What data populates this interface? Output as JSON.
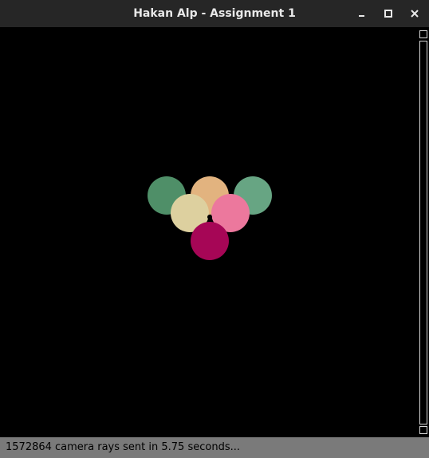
{
  "window": {
    "title": "Hakan Alp - Assignment 1",
    "controls": {
      "minimize_icon": "minimize-icon",
      "maximize_icon": "maximize-icon",
      "close_icon": "close-icon"
    }
  },
  "render": {
    "background": "#000000",
    "spheres": [
      {
        "name": "top-left",
        "color": "#4f8f68"
      },
      {
        "name": "top-center",
        "color": "#e2b37f"
      },
      {
        "name": "top-right",
        "color": "#67a583"
      },
      {
        "name": "middle-left",
        "color": "#ddd09f"
      },
      {
        "name": "middle-right",
        "color": "#ec789d"
      },
      {
        "name": "bottom",
        "color": "#a60656"
      }
    ]
  },
  "status": {
    "text": "1572864 camera rays sent in 5.75 seconds..."
  }
}
